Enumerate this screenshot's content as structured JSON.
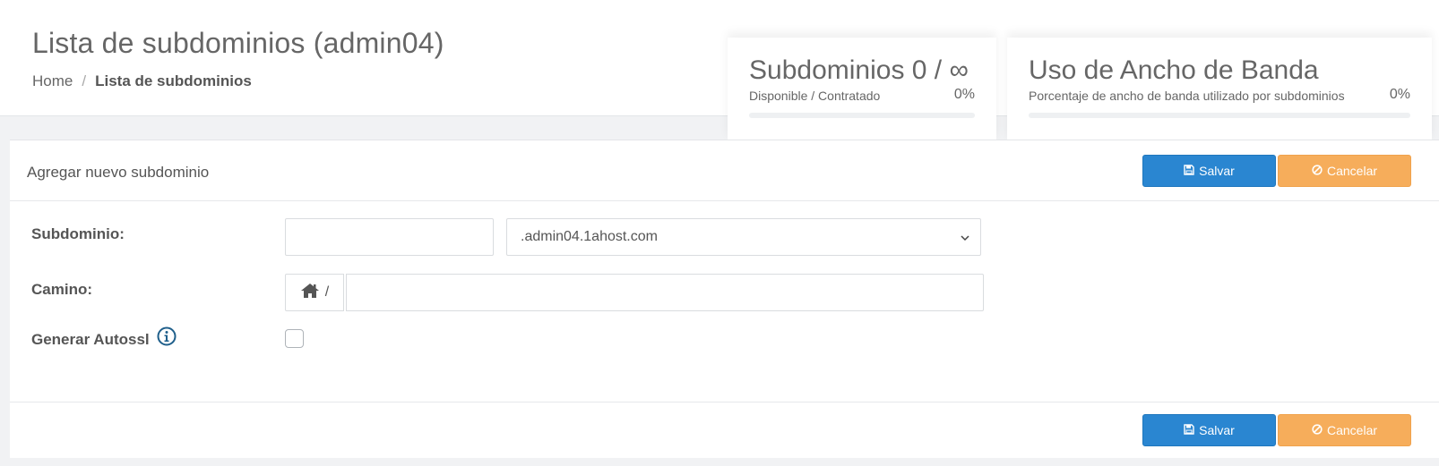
{
  "header": {
    "title": "Lista de subdominios (admin04)",
    "breadcrumb": {
      "home": "Home",
      "separator": "/",
      "current": "Lista de subdominios"
    }
  },
  "stats": {
    "subdomains": {
      "title": "Subdominios 0 / ∞",
      "subtitle": "Disponible / Contratado",
      "percent_text": "0%",
      "percent": 0
    },
    "bandwidth": {
      "title": "Uso de Ancho de Banda",
      "subtitle": "Porcentaje de ancho de banda utilizado por subdominios",
      "percent_text": "0%",
      "percent": 0
    }
  },
  "panel": {
    "title": "Agregar nuevo subdominio",
    "save_label": "Salvar",
    "cancel_label": "Cancelar"
  },
  "form": {
    "subdomain_label": "Subdominio:",
    "subdomain_value": "",
    "subdomain_placeholder": "",
    "domain_selected": ".admin04.1ahost.com",
    "path_label": "Camino:",
    "path_prefix": "/",
    "path_value": "",
    "autossl_label": "Generar Autossl",
    "autossl_checked": false
  },
  "colors": {
    "primary": "#2a86d1",
    "warning": "#f6ad5b",
    "info_icon": "#1f5f8b"
  },
  "icons": {
    "save": "floppy-disk-icon",
    "cancel": "ban-icon",
    "home": "home-icon",
    "info": "info-circle-icon",
    "select": "chevron-down-icon"
  }
}
